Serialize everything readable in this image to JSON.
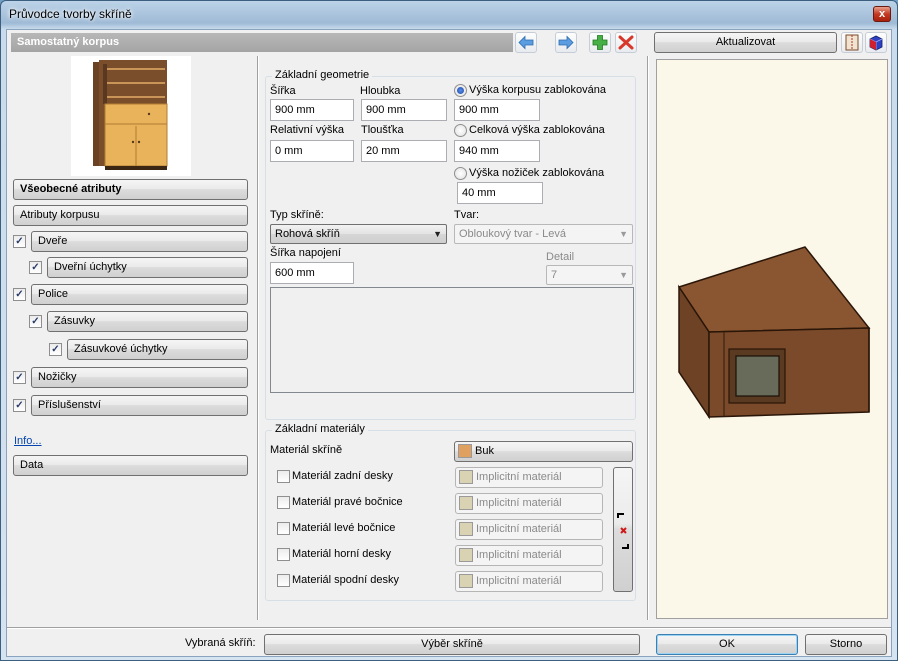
{
  "window": {
    "title": "Průvodce tvorby skříně",
    "close_symbol": "x"
  },
  "header": {
    "panel_title": "Samostatný korpus"
  },
  "toolbar": {
    "back_icon": "arrow-left-icon",
    "forward_icon": "arrow-right-icon",
    "add_icon": "plus-icon",
    "delete_icon": "delete-x-icon",
    "update_label": "Aktualizovat",
    "colors": {
      "arrow": "#4a90d9",
      "add": "#3aa23a",
      "delete": "#d43a2a"
    }
  },
  "left_nav": {
    "items": [
      {
        "label": "Všeobecné atributy"
      },
      {
        "label": "Atributy korpusu"
      },
      {
        "label": "Dveře",
        "checked": true
      },
      {
        "label": "Dveřní úchytky",
        "checked": true
      },
      {
        "label": "Police",
        "checked": true
      },
      {
        "label": "Zásuvky",
        "checked": true
      },
      {
        "label": "Zásuvkové úchytky",
        "checked": true
      },
      {
        "label": "Nožičky",
        "checked": true
      },
      {
        "label": "Příslušenství",
        "checked": true
      }
    ],
    "info_link": "Info...",
    "data_button": "Data"
  },
  "geometry": {
    "title": "Základní geometrie",
    "width_label": "Šířka",
    "width_value": "900 mm",
    "depth_label": "Hloubka",
    "depth_value": "900 mm",
    "relheight_label": "Relativní výška",
    "relheight_value": "0 mm",
    "thickness_label": "Tloušťka",
    "thickness_value": "20 mm",
    "radio_body_label": "Výška korpusu zablokována",
    "radio_body_value": "900 mm",
    "radio_total_label": "Celková výška zablokována",
    "radio_total_value": "940 mm",
    "radio_legs_label": "Výška nožiček zablokována",
    "radio_legs_value": "40 mm",
    "selected_radio": "body",
    "type_label": "Typ skříně:",
    "type_value": "Rohová skříň",
    "shape_label": "Tvar:",
    "shape_value": "Obloukový tvar - Levá",
    "joint_label": "Šířka napojení",
    "joint_value": "600 mm",
    "detail_label": "Detail",
    "detail_value": "7"
  },
  "materials": {
    "title": "Základní materiály",
    "main_label": "Materiál skříně",
    "main_value": "Buk",
    "main_color": "#e0a060",
    "default_label": "Implicitní materiál",
    "default_color": "#d9d3b4",
    "rows": [
      {
        "label": "Materiál zadní desky"
      },
      {
        "label": "Materiál pravé bočnice"
      },
      {
        "label": "Materiál levé bočnice"
      },
      {
        "label": "Materiál horní desky"
      },
      {
        "label": "Materiál spodní desky"
      }
    ]
  },
  "footer": {
    "selected_label": "Vybraná skříň:",
    "select_button": "Výběr skříně",
    "ok_button": "OK",
    "cancel_button": "Storno"
  }
}
